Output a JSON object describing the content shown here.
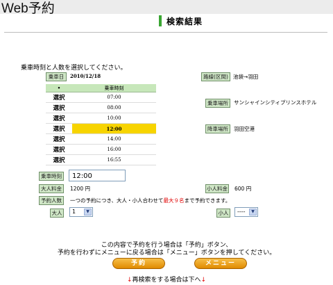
{
  "header": {
    "brand": "Web予約"
  },
  "page": {
    "title": "検索結果"
  },
  "instruction": "乗車時刻と人数を選択してください。",
  "boarding_date": {
    "label": "乗車日",
    "value": "2010/12/18"
  },
  "timetable": {
    "col_marker": "•",
    "col_time": "乗車時刻",
    "rows": [
      {
        "select": "選択",
        "time": "07:00"
      },
      {
        "select": "選択",
        "time": "08:00"
      },
      {
        "select": "選択",
        "time": "10:00"
      },
      {
        "select": "選択",
        "time": "12:00"
      },
      {
        "select": "選択",
        "time": "14:00"
      },
      {
        "select": "選択",
        "time": "16:00"
      },
      {
        "select": "選択",
        "time": "16:55"
      }
    ],
    "highlighted_time": "12:00"
  },
  "route": {
    "label": "路線(区間)",
    "value": "池袋→羽田"
  },
  "boarding_place": {
    "label": "乗車場所",
    "value": "サンシャインシティプリンスホテル"
  },
  "alighting_place": {
    "label": "降車場所",
    "value": "羽田空港"
  },
  "boarding_time": {
    "label": "乗車時刻",
    "value": "12:00"
  },
  "adult_fare": {
    "label": "大人料金",
    "value": "1200 円"
  },
  "child_fare": {
    "label": "小人料金",
    "value": "600 円"
  },
  "reservable": {
    "label": "予約人数",
    "note_before": "一つの予約につき、大人・小人合わせて",
    "note_highlight": "最大９名",
    "note_after": "まで予約できます。"
  },
  "adults": {
    "label": "大人",
    "value": "1"
  },
  "children": {
    "label": "小人",
    "value": "----"
  },
  "confirm": {
    "line1": "この内容で予約を行う場合は「予約」ボタン、",
    "line2": "予約を行わずにメニューに戻る場合は「メニュー」ボタンを押してください。"
  },
  "buttons": {
    "reserve": "予約",
    "menu": "メニュー"
  },
  "research": {
    "arrow": "↓",
    "text": "再検索をする場合は下へ"
  },
  "colors": {
    "accent_green": "#3aa632",
    "highlight_yellow": "#f7d400",
    "button_orange": "#e08a00"
  }
}
